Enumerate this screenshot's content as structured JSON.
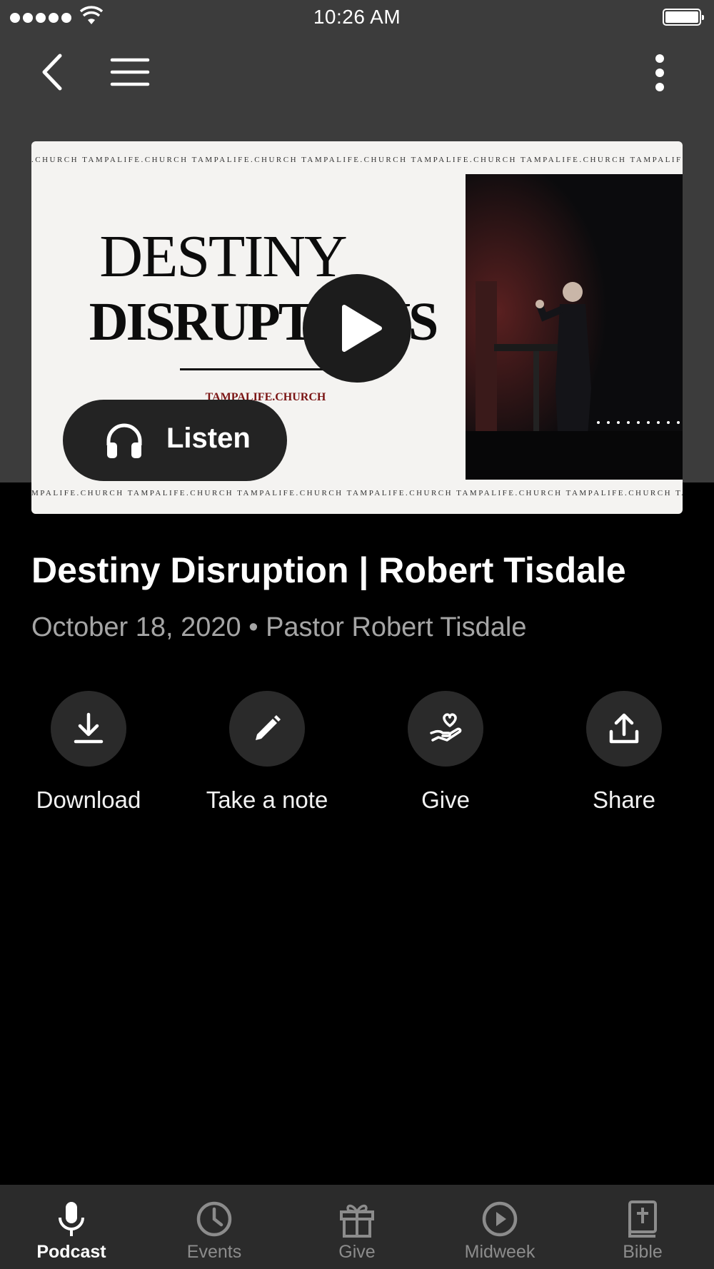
{
  "status_bar": {
    "time": "10:26 AM"
  },
  "nav": {
    "back_icon": "chevron-left-icon",
    "menu_icon": "hamburger-menu-icon",
    "more_icon": "more-vertical-icon"
  },
  "artwork": {
    "ticker_text": ".CHURCH TAMPALIFE.CHURCH TAMPALIFE.CHURCH TAMPALIFE.CHURCH TAMPALIFE.CHURCH TAMPALIFE.CHURCH TAMPALIFE.CHURCH TAMPALIFE.CHURCH TAMPALIFE.CHURCH",
    "ticker_text_bottom": "MPALIFE.CHURCH TAMPALIFE.CHURCH TAMPALIFE.CHURCH TAMPALIFE.CHURCH TAMPALIFE.CHURCH TAMPALIFE.CHURCH TAMPALIFE.CHURCH TAMPALIFE.CHURCH TAMPALIFE.CHURCH",
    "title_line1": "DESTINY",
    "title_line2": "DISRUPTIONS",
    "brand": "TAMPALIFE.CHURCH"
  },
  "listen_button": {
    "label": "Listen"
  },
  "sermon": {
    "title": "Destiny Disruption | Robert Tisdale",
    "meta": "October 18, 2020 • Pastor Robert Tisdale"
  },
  "actions": [
    {
      "label": "Download",
      "icon": "download-icon"
    },
    {
      "label": "Take a note",
      "icon": "pencil-icon"
    },
    {
      "label": "Give",
      "icon": "heart-hand-icon"
    },
    {
      "label": "Share",
      "icon": "share-icon"
    }
  ],
  "tabs": [
    {
      "label": "Podcast",
      "icon": "microphone-icon",
      "active": true
    },
    {
      "label": "Events",
      "icon": "clock-icon"
    },
    {
      "label": "Give",
      "icon": "gift-icon"
    },
    {
      "label": "Midweek",
      "icon": "play-circle-icon"
    },
    {
      "label": "Bible",
      "icon": "bible-icon"
    }
  ],
  "colors": {
    "header_bg": "#3c3c3c",
    "page_bg": "#000000",
    "tab_bar_bg": "#2b2b2b",
    "brand_red": "#7a1414"
  }
}
